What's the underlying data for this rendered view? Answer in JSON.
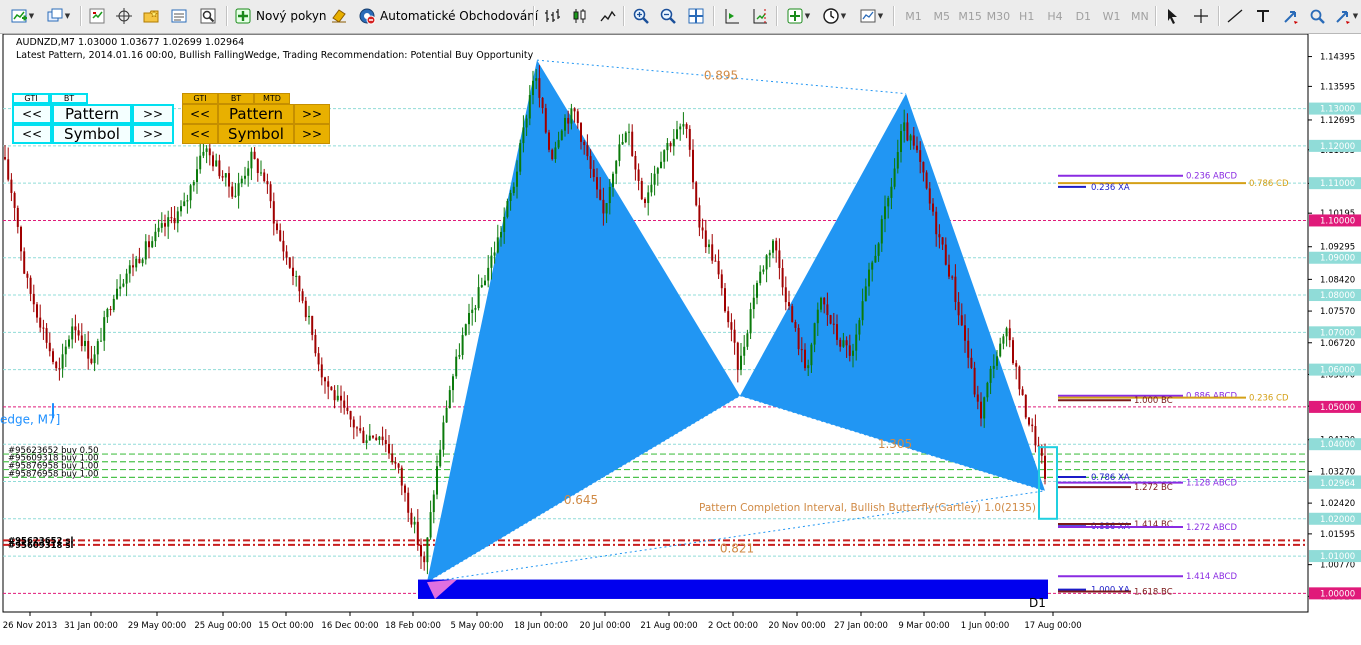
{
  "toolbar": {
    "new_order_label": "Nový pokyn",
    "autotrading_label": "Automatické Obchodování",
    "timeframes": [
      "M1",
      "M5",
      "M15",
      "M30",
      "H1",
      "H4",
      "D1",
      "W1",
      "MN"
    ],
    "icons": [
      "new-chart-icon",
      "profiles-icon",
      "market-watch-icon",
      "crosshair-move-icon",
      "favorites-icon",
      "data-window-icon",
      "strategy-tester-icon",
      "new-order-icon",
      "autotrading-icon",
      "bar-chart-icon",
      "candlestick-icon",
      "line-chart-icon",
      "zoom-in-icon",
      "zoom-out-icon",
      "tile-windows-icon",
      "auto-scroll-icon",
      "chart-shift-icon",
      "indicators-icon",
      "periods-icon",
      "templates-icon",
      "cursor-icon",
      "crosshair-icon",
      "trendline-icon",
      "text-icon",
      "arrows-icon"
    ]
  },
  "chart_header": {
    "symbol_line": "AUDNZD,M7  1.03000 1.03677 1.02699 1.02964",
    "pattern_line": "Latest Pattern, 2014.01.16 00:00, Bullish FallingWedge, Trading Recommendation: Potential Buy Opportunity"
  },
  "nav_panels": [
    {
      "tags": [
        "GTI",
        "BT"
      ],
      "prev": "<<",
      "next": ">>",
      "row1": "Pattern",
      "row2": "Symbol",
      "style": "cyan"
    },
    {
      "tags": [
        "GTI",
        "BT",
        "MTD"
      ],
      "prev": "<<",
      "next": ">>",
      "row1": "Pattern",
      "row2": "Symbol",
      "style": "orange"
    }
  ],
  "chart_data": {
    "type": "candlestick",
    "symbol": "AUDNZD",
    "period": "M7",
    "ohlc_current": {
      "open": 1.03,
      "high": 1.03677,
      "low": 1.02699,
      "close": 1.02964
    },
    "ylim": [
      0.995,
      1.15
    ],
    "xlim": [
      0,
      1305
    ],
    "y_ticks": [
      1.14395,
      1.13595,
      1.12695,
      1.11895,
      1.10995,
      1.10195,
      1.09295,
      1.0842,
      1.0757,
      1.0672,
      1.0587,
      1.0502,
      1.0412,
      1.0327,
      1.0242,
      1.01595,
      1.0077,
      0.9992
    ],
    "x_tick_labels": [
      "26 Nov 2013",
      "31 Jan 00:00",
      "29 May 00:00",
      "25 Aug 00:00",
      "15 Oct 00:00",
      "16 Dec 00:00",
      "18 Feb 00:00",
      "5 May 00:00",
      "18 Jun 00:00",
      "20 Jul 00:00",
      "21 Aug 00:00",
      "2 Oct 00:00",
      "20 Nov 00:00",
      "27 Jan 00:00",
      "9 Mar 00:00",
      "1 Jun 00:00",
      "17 Aug 00:00"
    ],
    "x_tick_positions": [
      30,
      91,
      157,
      223,
      286,
      350,
      413,
      477,
      541,
      605,
      669,
      733,
      797,
      861,
      924,
      985,
      1053
    ],
    "level_lines": [
      {
        "price": 1.13,
        "label": "1.13000",
        "color": "#90dcd8",
        "style": "dashed"
      },
      {
        "price": 1.12,
        "label": "1.12000",
        "color": "#90dcd8",
        "style": "dashed"
      },
      {
        "price": 1.11,
        "label": "1.11000",
        "color": "#90dcd8",
        "style": "dashed"
      },
      {
        "price": 1.1,
        "label": "1.10000",
        "color": "#e01a7a",
        "style": "dashed"
      },
      {
        "price": 1.09,
        "label": "1.09000",
        "color": "#90dcd8",
        "style": "dashed"
      },
      {
        "price": 1.08,
        "label": "1.08000",
        "color": "#90dcd8",
        "style": "dashed"
      },
      {
        "price": 1.07,
        "label": "1.07000",
        "color": "#90dcd8",
        "style": "dashed"
      },
      {
        "price": 1.06,
        "label": "1.06000",
        "color": "#90dcd8",
        "style": "dashed"
      },
      {
        "price": 1.05,
        "label": "1.05000",
        "color": "#e01a7a",
        "style": "dashed"
      },
      {
        "price": 1.04,
        "label": "1.04000",
        "color": "#90dcd8",
        "style": "dashed"
      },
      {
        "price": 1.03,
        "label": "1.03000",
        "color": "#90dcd8",
        "style": "dashed"
      },
      {
        "price": 1.02,
        "label": "1.02000",
        "color": "#90dcd8",
        "style": "dashed"
      },
      {
        "price": 1.01,
        "label": "1.01000",
        "color": "#90dcd8",
        "style": "dashed"
      },
      {
        "price": 1.0,
        "label": "1.00000",
        "color": "#e01a7a",
        "style": "dashed"
      }
    ],
    "order_lines": [
      {
        "price": 1.03735,
        "label": "#95623652 buy 0.50",
        "color": "#4cc24c"
      },
      {
        "price": 1.0353,
        "label": "#95609318 buy 1.00",
        "color": "#4cc24c"
      },
      {
        "price": 1.0332,
        "label": "#95876958 buy 1.00",
        "color": "#4cc24c"
      },
      {
        "price": 1.0311,
        "label": "#95876958 buy 1.00",
        "color": "#4cc24c"
      },
      {
        "price": 1.0142,
        "label": "#95623652 sl",
        "color": "#c81e1e"
      },
      {
        "price": 1.013,
        "label": "#95609318 sl",
        "color": "#c81e1e"
      }
    ],
    "harmonic_pattern": {
      "name": "Bullish Gartley",
      "points": {
        "X": {
          "x": 424,
          "price": 1.003
        },
        "A": {
          "x": 534,
          "price": 1.143
        },
        "B": {
          "x": 737,
          "price": 1.053
        },
        "C": {
          "x": 903,
          "price": 1.134
        },
        "D": {
          "x": 1042,
          "price": 1.0275
        }
      },
      "ratios": [
        {
          "text": "0.895",
          "x": 718,
          "price": 1.1378
        },
        {
          "text": "0.645",
          "x": 578,
          "price": 1.024
        },
        {
          "text": "0.821",
          "x": 734,
          "price": 1.0109
        },
        {
          "text": "1.305",
          "x": 892,
          "price": 1.039
        }
      ],
      "completion_label": "Pattern Completion Interval, Bullish Butterfly(Gartley) 1.0(2135)",
      "completion_zone": {
        "x0": 1036,
        "x1": 1054,
        "price_top": 1.0392,
        "price_bottom": 1.02
      }
    },
    "projection_levels": [
      {
        "label": "0.236 ABCD",
        "price": 1.112,
        "x0": 1055,
        "x1": 1180,
        "color": "#8a2be2"
      },
      {
        "label": "0.786 CD",
        "price": 1.11,
        "x0": 1055,
        "x1": 1243,
        "color": "#d4a017"
      },
      {
        "label": "0.236 XA",
        "price": 1.109,
        "x0": 1055,
        "x1": 1083,
        "color": "#1c1cc8"
      },
      {
        "label": "0.886 ABCD",
        "price": 1.053,
        "x0": 1055,
        "x1": 1180,
        "color": "#8a2be2"
      },
      {
        "label": "0.236 CD",
        "price": 1.0525,
        "x0": 1055,
        "x1": 1243,
        "color": "#d4a017"
      },
      {
        "label": "1.000 BC",
        "price": 1.0518,
        "x0": 1055,
        "x1": 1128,
        "color": "#7a1a1a"
      },
      {
        "label": "0.786 XA",
        "price": 1.0312,
        "x0": 1055,
        "x1": 1083,
        "color": "#1c1cc8"
      },
      {
        "label": "1.128 ABCD",
        "price": 1.0297,
        "x0": 1055,
        "x1": 1180,
        "color": "#8a2be2"
      },
      {
        "label": "1.272 BC",
        "price": 1.0285,
        "x0": 1055,
        "x1": 1128,
        "color": "#7a1a1a"
      },
      {
        "label": "0.886 XA",
        "price": 1.018,
        "x0": 1055,
        "x1": 1083,
        "color": "#1c1cc8"
      },
      {
        "label": "1.414 BC",
        "price": 1.0186,
        "x0": 1055,
        "x1": 1128,
        "color": "#7a1a1a"
      },
      {
        "label": "1.272 ABCD",
        "price": 1.0178,
        "x0": 1055,
        "x1": 1180,
        "color": "#8a2be2"
      },
      {
        "label": "1.414 ABCD",
        "price": 1.0046,
        "x0": 1055,
        "x1": 1180,
        "color": "#8a2be2"
      },
      {
        "label": "1.000 XA",
        "price": 1.001,
        "x0": 1055,
        "x1": 1083,
        "color": "#1c1cc8"
      },
      {
        "label": "1.618 BC",
        "price": 1.0005,
        "x0": 1055,
        "x1": 1128,
        "color": "#7a1a1a"
      }
    ],
    "wedge_label": "edge, M7]",
    "period_marker": "D1",
    "colors": {
      "bull": "#0b7a0b",
      "bear": "#a00000",
      "pattern_fill": "#2196f3",
      "blue_band": "#0000ee",
      "price_label_bg": "#ff0000"
    }
  }
}
